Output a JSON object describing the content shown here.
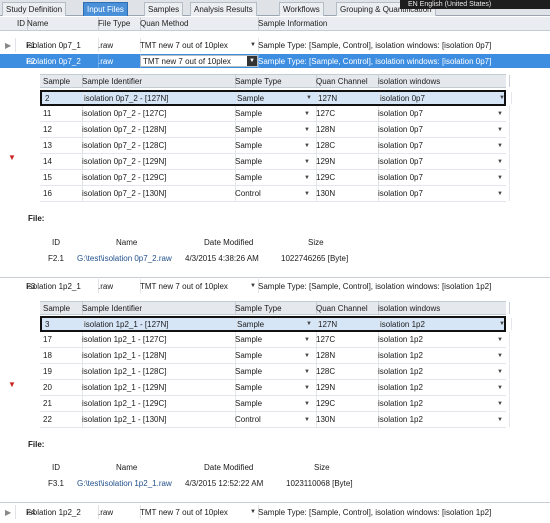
{
  "tabs": [
    "Study Definition",
    "Input Files",
    "Samples",
    "Analysis Results",
    "Workflows",
    "Grouping & Quantification"
  ],
  "active_tab": "Input Files",
  "language_indicator": "EN English (United States)",
  "columns": {
    "id": "ID",
    "name": "Name",
    "file_type": "File Type",
    "quan_method": "Quan Method",
    "sample_info": "Sample Information"
  },
  "sample_columns": {
    "sample": "Sample",
    "identifier": "Sample Identifier",
    "type": "Sample Type",
    "channel": "Quan Channel",
    "windows": "isolation windows"
  },
  "file_columns": {
    "id": "ID",
    "name": "Name",
    "date": "Date Modified",
    "size": "Size"
  },
  "file_label": "File:",
  "files": [
    {
      "id": "F1",
      "name": "isolation 0p7_1",
      "type": ".raw",
      "method": "TMT new 7 out of 10plex",
      "info": "Sample Type: [Sample, Control], isolation windows: [isolation 0p7]"
    },
    {
      "id": "F2",
      "name": "isolation 0p7_2",
      "type": ".raw",
      "method": "TMT new 7 out of 10plex",
      "info": "Sample Type: [Sample, Control], isolation windows: [isolation 0p7]"
    },
    {
      "id": "F3",
      "name": "isolation 1p2_1",
      "type": ".raw",
      "method": "TMT new 7 out of 10plex",
      "info": "Sample Type: [Sample, Control], isolation windows: [isolation 1p2]"
    },
    {
      "id": "F4",
      "name": "isolation 1p2_2",
      "type": ".raw",
      "method": "TMT new 7 out of 10plex",
      "info": "Sample Type: [Sample, Control], isolation windows: [isolation 1p2]"
    }
  ],
  "samples_f2": [
    {
      "n": "2",
      "id": "isolation 0p7_2 - [127N]",
      "type": "Sample",
      "ch": "127N",
      "win": "isolation 0p7"
    },
    {
      "n": "11",
      "id": "isolation 0p7_2 - [127C]",
      "type": "Sample",
      "ch": "127C",
      "win": "isolation 0p7"
    },
    {
      "n": "12",
      "id": "isolation 0p7_2 - [128N]",
      "type": "Sample",
      "ch": "128N",
      "win": "isolation 0p7"
    },
    {
      "n": "13",
      "id": "isolation 0p7_2 - [128C]",
      "type": "Sample",
      "ch": "128C",
      "win": "isolation 0p7"
    },
    {
      "n": "14",
      "id": "isolation 0p7_2 - [129N]",
      "type": "Sample",
      "ch": "129N",
      "win": "isolation 0p7"
    },
    {
      "n": "15",
      "id": "isolation 0p7_2 - [129C]",
      "type": "Sample",
      "ch": "129C",
      "win": "isolation 0p7"
    },
    {
      "n": "16",
      "id": "isolation 0p7_2 - [130N]",
      "type": "Control",
      "ch": "130N",
      "win": "isolation 0p7"
    }
  ],
  "samples_f3": [
    {
      "n": "3",
      "id": "isolation 1p2_1 - [127N]",
      "type": "Sample",
      "ch": "127N",
      "win": "isolation 1p2"
    },
    {
      "n": "17",
      "id": "isolation 1p2_1 - [127C]",
      "type": "Sample",
      "ch": "127C",
      "win": "isolation 1p2"
    },
    {
      "n": "18",
      "id": "isolation 1p2_1 - [128N]",
      "type": "Sample",
      "ch": "128N",
      "win": "isolation 1p2"
    },
    {
      "n": "19",
      "id": "isolation 1p2_1 - [128C]",
      "type": "Sample",
      "ch": "128C",
      "win": "isolation 1p2"
    },
    {
      "n": "20",
      "id": "isolation 1p2_1 - [129N]",
      "type": "Sample",
      "ch": "129N",
      "win": "isolation 1p2"
    },
    {
      "n": "21",
      "id": "isolation 1p2_1 - [129C]",
      "type": "Sample",
      "ch": "129C",
      "win": "isolation 1p2"
    },
    {
      "n": "22",
      "id": "isolation 1p2_1 - [130N]",
      "type": "Control",
      "ch": "130N",
      "win": "isolation 1p2"
    }
  ],
  "file_details": [
    {
      "id": "F2.1",
      "name": "G:\\test\\isolation 0p7_2.raw",
      "date": "4/3/2015 4:38:26 AM",
      "size": "1022746265 [Byte]"
    },
    {
      "id": "F3.1",
      "name": "G:\\test\\isolation 1p2_1.raw",
      "date": "4/3/2015 12:52:22 AM",
      "size": "1023110068 [Byte]"
    }
  ],
  "colors": {
    "selected_row": "#3d8ee0",
    "active_tab": "#4a90d9",
    "expand_arrow": "#cc2222"
  },
  "icons": {
    "collapsed": "triangle-right",
    "expanded": "triangle-down",
    "dropdown": "triangle-down"
  }
}
